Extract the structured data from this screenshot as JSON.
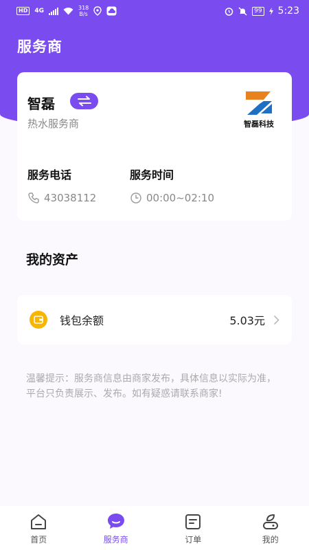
{
  "status_bar": {
    "network_badge": "HD",
    "network_type": "4G",
    "speed_value": "318",
    "speed_unit": "B/s",
    "battery": "99",
    "time": "5:23"
  },
  "header": {
    "title": "服务商"
  },
  "provider": {
    "name": "智磊",
    "type": "热水服务商",
    "logo_text": "智磊科技",
    "phone_label": "服务电话",
    "phone": "43038112",
    "hours_label": "服务时间",
    "hours": "00:00~02:10"
  },
  "assets": {
    "title": "我的资产",
    "wallet_label": "钱包余额",
    "wallet_amount": "5.03元"
  },
  "notice": "温馨提示：服务商信息由商家发布，具体信息以实际为准，平台只负责展示、发布。如有疑惑请联系商家!",
  "tabbar": {
    "items": [
      {
        "label": "首页",
        "icon": "home-icon"
      },
      {
        "label": "服务商",
        "icon": "chat-bubble-icon"
      },
      {
        "label": "订单",
        "icon": "order-icon"
      },
      {
        "label": "我的",
        "icon": "profile-icon"
      }
    ],
    "active_index": 1
  },
  "colors": {
    "primary": "#7a4cf0",
    "wallet_icon": "#f7b500",
    "logo_orange": "#e8821e",
    "logo_blue": "#1f6fc2"
  }
}
